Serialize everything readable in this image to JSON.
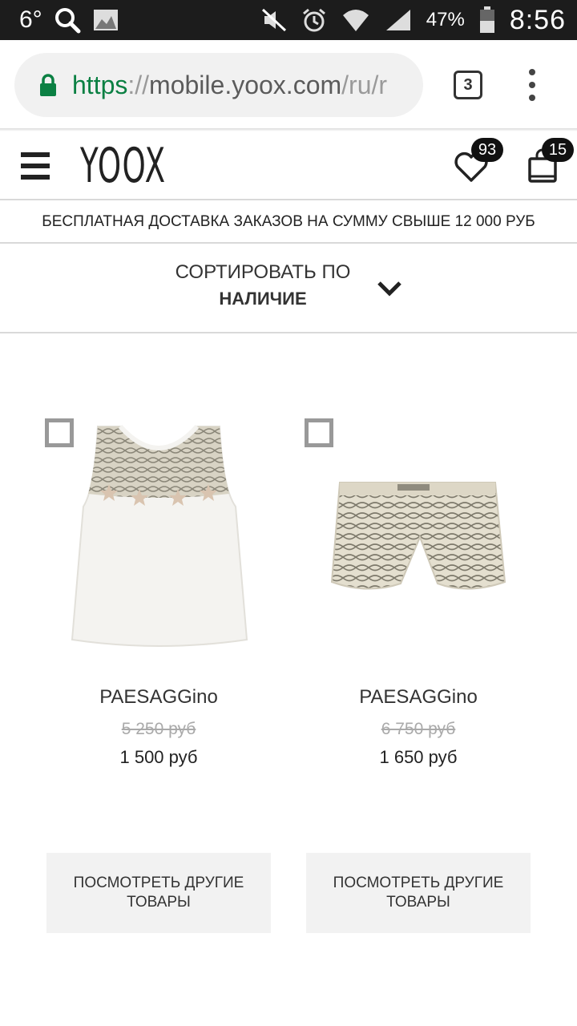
{
  "status_bar": {
    "temperature": "6°",
    "battery": "47%",
    "time": "8:56"
  },
  "browser": {
    "url_scheme": "https",
    "url_sep": "://",
    "url_host": "mobile.yoox.com",
    "url_path": "/ru/r",
    "tab_count": "3"
  },
  "header": {
    "logo": "YOOX",
    "wishlist_count": "93",
    "bag_count": "15"
  },
  "promo": "БЕСПЛАТНАЯ ДОСТАВКА ЗАКАЗОВ НА СУММУ СВЫШЕ 12 000 РУБ",
  "sort": {
    "label": "СОРТИРОВАТЬ ПО",
    "value": "НАЛИЧИЕ"
  },
  "products": [
    {
      "brand": "PAESAGGino",
      "old_price": "5 250 руб",
      "price": "1 500 руб",
      "more_label": "ПОСМОТРЕТЬ ДРУГИЕ ТОВАРЫ"
    },
    {
      "brand": "PAESAGGino",
      "old_price": "6 750 руб",
      "price": "1 650 руб",
      "more_label": "ПОСМОТРЕТЬ ДРУГИЕ ТОВАРЫ"
    }
  ],
  "colors": {
    "status_bar": "#1c1c1c",
    "secure_green": "#0b8043",
    "badge": "#111111",
    "button_bg": "#f2f2f2"
  }
}
